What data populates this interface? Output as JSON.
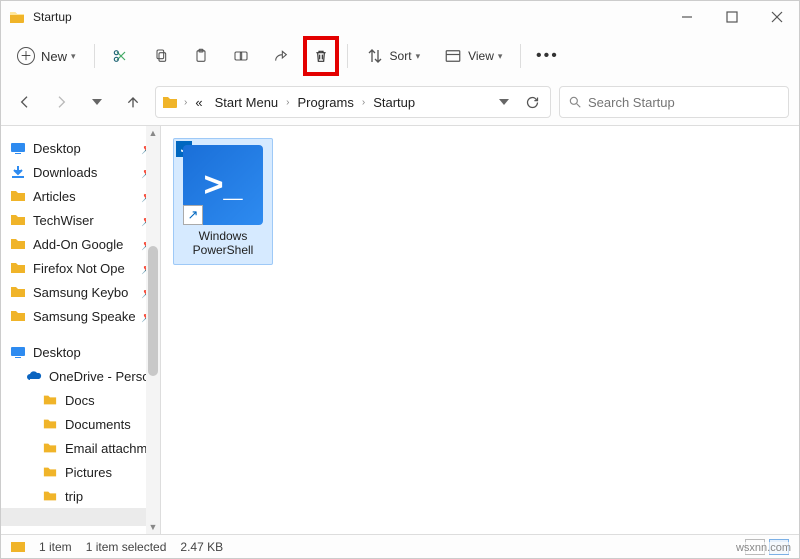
{
  "window": {
    "title": "Startup"
  },
  "toolbar": {
    "new_label": "New",
    "sort_label": "Sort",
    "view_label": "View"
  },
  "breadcrumb": {
    "items": [
      "Start Menu",
      "Programs",
      "Startup"
    ]
  },
  "search": {
    "placeholder": "Search Startup"
  },
  "sidebar": {
    "quick": [
      {
        "label": "Desktop",
        "icon": "desktop",
        "pinned": true
      },
      {
        "label": "Downloads",
        "icon": "downloads",
        "pinned": true
      },
      {
        "label": "Articles",
        "icon": "folder",
        "pinned": true
      },
      {
        "label": "TechWiser",
        "icon": "folder",
        "pinned": true
      },
      {
        "label": "Add-On Google",
        "icon": "folder",
        "pinned": true
      },
      {
        "label": "Firefox Not Ope",
        "icon": "folder",
        "pinned": true
      },
      {
        "label": "Samsung Keybo",
        "icon": "folder",
        "pinned": true
      },
      {
        "label": "Samsung Speake",
        "icon": "folder",
        "pinned": true
      }
    ],
    "desktop_label": "Desktop",
    "onedrive_label": "OneDrive - Perso",
    "onedrive_children": [
      {
        "label": "Docs"
      },
      {
        "label": "Documents"
      },
      {
        "label": "Email attachme"
      },
      {
        "label": "Pictures"
      },
      {
        "label": "trip"
      }
    ]
  },
  "files": {
    "items": [
      {
        "name": "Windows PowerShell",
        "selected": true
      }
    ]
  },
  "statusbar": {
    "count": "1 item",
    "selected": "1 item selected",
    "size": "2.47 KB"
  },
  "watermark": "wsxnn.com"
}
